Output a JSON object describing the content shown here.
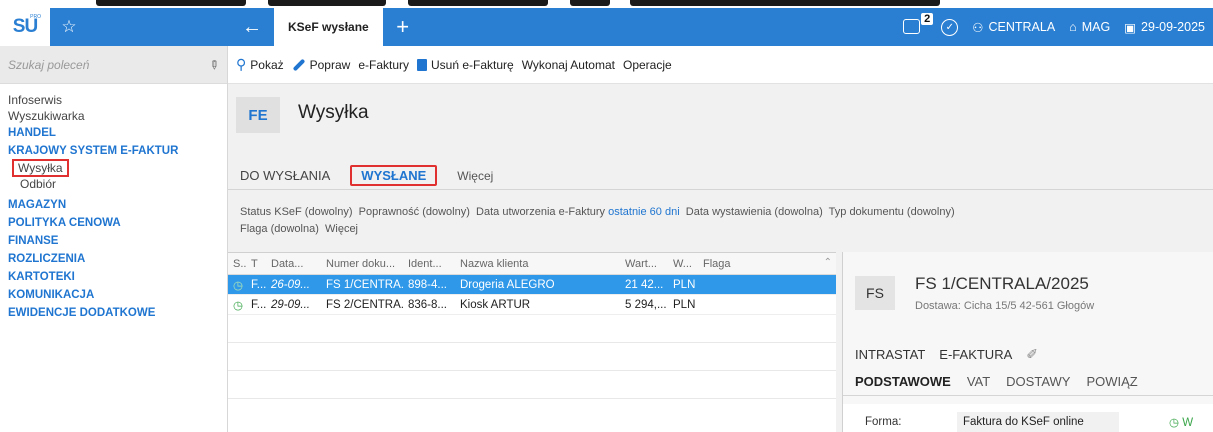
{
  "app": {
    "logo_text": "SU",
    "logo_sub": "PRO",
    "favorite_icon": "star-icon",
    "active_tab": "KSeF wysłane",
    "notifications_count": "2",
    "company": "CENTRALA",
    "warehouse": "MAG",
    "date": "29-09-2025",
    "accent_color": "#2a7fd2"
  },
  "sidebar": {
    "search_placeholder": "Szukaj poleceń",
    "items": [
      {
        "label": "Infoserwis",
        "type": "item"
      },
      {
        "label": "Wyszukiwarka",
        "type": "item"
      },
      {
        "label": "HANDEL",
        "type": "section"
      },
      {
        "label": "KRAJOWY SYSTEM E-FAKTUR",
        "type": "section"
      },
      {
        "label": "Wysyłka",
        "type": "sub-selected"
      },
      {
        "label": "Odbiór",
        "type": "sub"
      },
      {
        "label": "MAGAZYN",
        "type": "section"
      },
      {
        "label": "POLITYKA CENOWA",
        "type": "section"
      },
      {
        "label": "FINANSE",
        "type": "section"
      },
      {
        "label": "ROZLICZENIA",
        "type": "section"
      },
      {
        "label": "KARTOTEKI",
        "type": "section"
      },
      {
        "label": "KOMUNIKACJA",
        "type": "section"
      },
      {
        "label": "EWIDENCJE DODATKOWE",
        "type": "section"
      }
    ]
  },
  "toolbar": {
    "show": "Pokaż",
    "fix": "Popraw",
    "einvoices": "e-Faktury",
    "delete": "Usuń e-Fakturę",
    "automat": "Wykonaj Automat",
    "operations": "Operacje"
  },
  "page": {
    "code": "FE",
    "title": "Wysyłka",
    "tabs": {
      "to_send": "DO WYSŁANIA",
      "sent": "WYSŁANE",
      "more": "Więcej"
    }
  },
  "filters": {
    "ksef_status": "Status KSeF (dowolny)",
    "validity": "Poprawność (dowolny)",
    "created_label": "Data utworzenia e-Faktury",
    "created_value": "ostatnie 60 dni",
    "issued": "Data wystawienia (dowolna)",
    "doc_type": "Typ dokumentu (dowolny)",
    "flag": "Flaga (dowolna)",
    "more": "Więcej"
  },
  "grid": {
    "columns": [
      "S...",
      "T",
      "Data...",
      "Numer doku...",
      "Ident...",
      "Nazwa klienta",
      "Wart...",
      "W...",
      "Flaga"
    ],
    "rows": [
      {
        "status": "◷",
        "type": "F...",
        "date": "26-09...",
        "number": "FS 1/CENTRA...",
        "ident": "898-4...",
        "client": "Drogeria ALEGRO",
        "value": "21 42...",
        "currency": "PLN",
        "flag": ""
      },
      {
        "status": "◷",
        "type": "F...",
        "date": "29-09...",
        "number": "FS 2/CENTRA...",
        "ident": "836-8...",
        "client": "Kiosk ARTUR",
        "value": "5 294,...",
        "currency": "PLN",
        "flag": ""
      }
    ]
  },
  "detail": {
    "code": "FS",
    "number": "FS 1/CENTRALA/2025",
    "delivery": "Dostawa: Cicha 15/5 42-561 Głogów",
    "tabs1": [
      "INTRASTAT",
      "E-FAKTURA"
    ],
    "tabs2": [
      "PODSTAWOWE",
      "VAT",
      "DOSTAWY",
      "POWIĄZ"
    ],
    "form_label": "Forma:",
    "form_value": "Faktura do KSeF online",
    "status_fragment": "W"
  }
}
